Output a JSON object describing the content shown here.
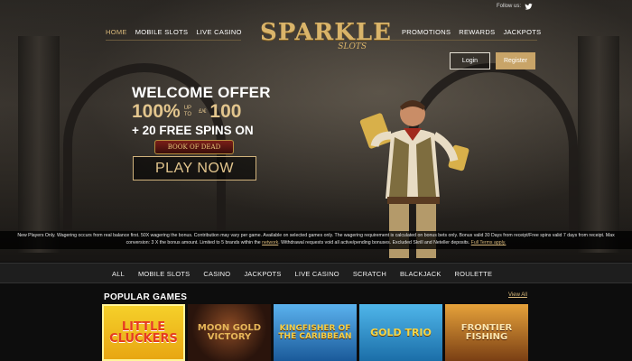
{
  "topbar": {
    "follow_label": "Follow us:",
    "icon": "twitter-icon"
  },
  "nav": {
    "left": [
      {
        "label": "HOME",
        "active": true
      },
      {
        "label": "MOBILE SLOTS",
        "active": false
      },
      {
        "label": "LIVE CASINO",
        "active": false
      }
    ],
    "right": [
      {
        "label": "PROMOTIONS"
      },
      {
        "label": "REWARDS"
      },
      {
        "label": "JACKPOTS"
      }
    ]
  },
  "logo": {
    "main": "SPARKLE",
    "sub": "SLOTS"
  },
  "auth": {
    "login": "Login",
    "register": "Register"
  },
  "hero": {
    "welcome": "WELCOME OFFER",
    "percent": "100%",
    "up_to_top": "UP",
    "up_to_bottom": "TO",
    "currency": "£/€",
    "amount": "100",
    "spins": "+ 20 FREE SPINS ON",
    "game_name": "BOOK OF DEAD",
    "cta": "PLAY NOW"
  },
  "terms": {
    "text_before": "New Players Only. Wagering occurs from real balance first. 50X wagering the bonus. Contribution may vary per game. Available on selected games only. The wagering requirement is calculated on bonus bets only. Bonus valid 30 Days from receipt/Free spins valid 7 days from receipt. Max conversion: 3 X the bonus amount. Limited to 5 brands within the ",
    "link_network": "network",
    "text_after": ". Withdrawal requests void all active/pending bonuses. Excluded Skrill and Neteller deposits. ",
    "link_terms": "Full Terms apply."
  },
  "game_nav": [
    "ALL",
    "MOBILE SLOTS",
    "CASINO",
    "JACKPOTS",
    "LIVE CASINO",
    "SCRATCH",
    "BLACKJACK",
    "ROULETTE"
  ],
  "popular": {
    "title": "POPULAR GAMES",
    "view_all": "View All",
    "games": [
      {
        "title": "LITTLE CLUCKERS",
        "bg1": "#f5d02a",
        "bg2": "#e8a612",
        "color": "#e63b1f"
      },
      {
        "title": "MOON GOLD VICTORY",
        "bg1": "#5b2a1d",
        "bg2": "#1b0f0b",
        "color": "#e6b659"
      },
      {
        "title": "KINGFISHER OF THE CARIBBEAN",
        "bg1": "#2f8bd6",
        "bg2": "#1a5a9a",
        "color": "#f2cf4a"
      },
      {
        "title": "GOLD TRIO",
        "bg1": "#3aa7e0",
        "bg2": "#1b6ea8",
        "color": "#f4d64a"
      },
      {
        "title": "FRONTIER FISHING",
        "bg1": "#d9902b",
        "bg2": "#7a3f14",
        "color": "#fbe6b0"
      }
    ]
  },
  "colors": {
    "gold": "#d8b87a",
    "register_bg": "#c8a468",
    "nav_bg": "#1e1e1e"
  }
}
